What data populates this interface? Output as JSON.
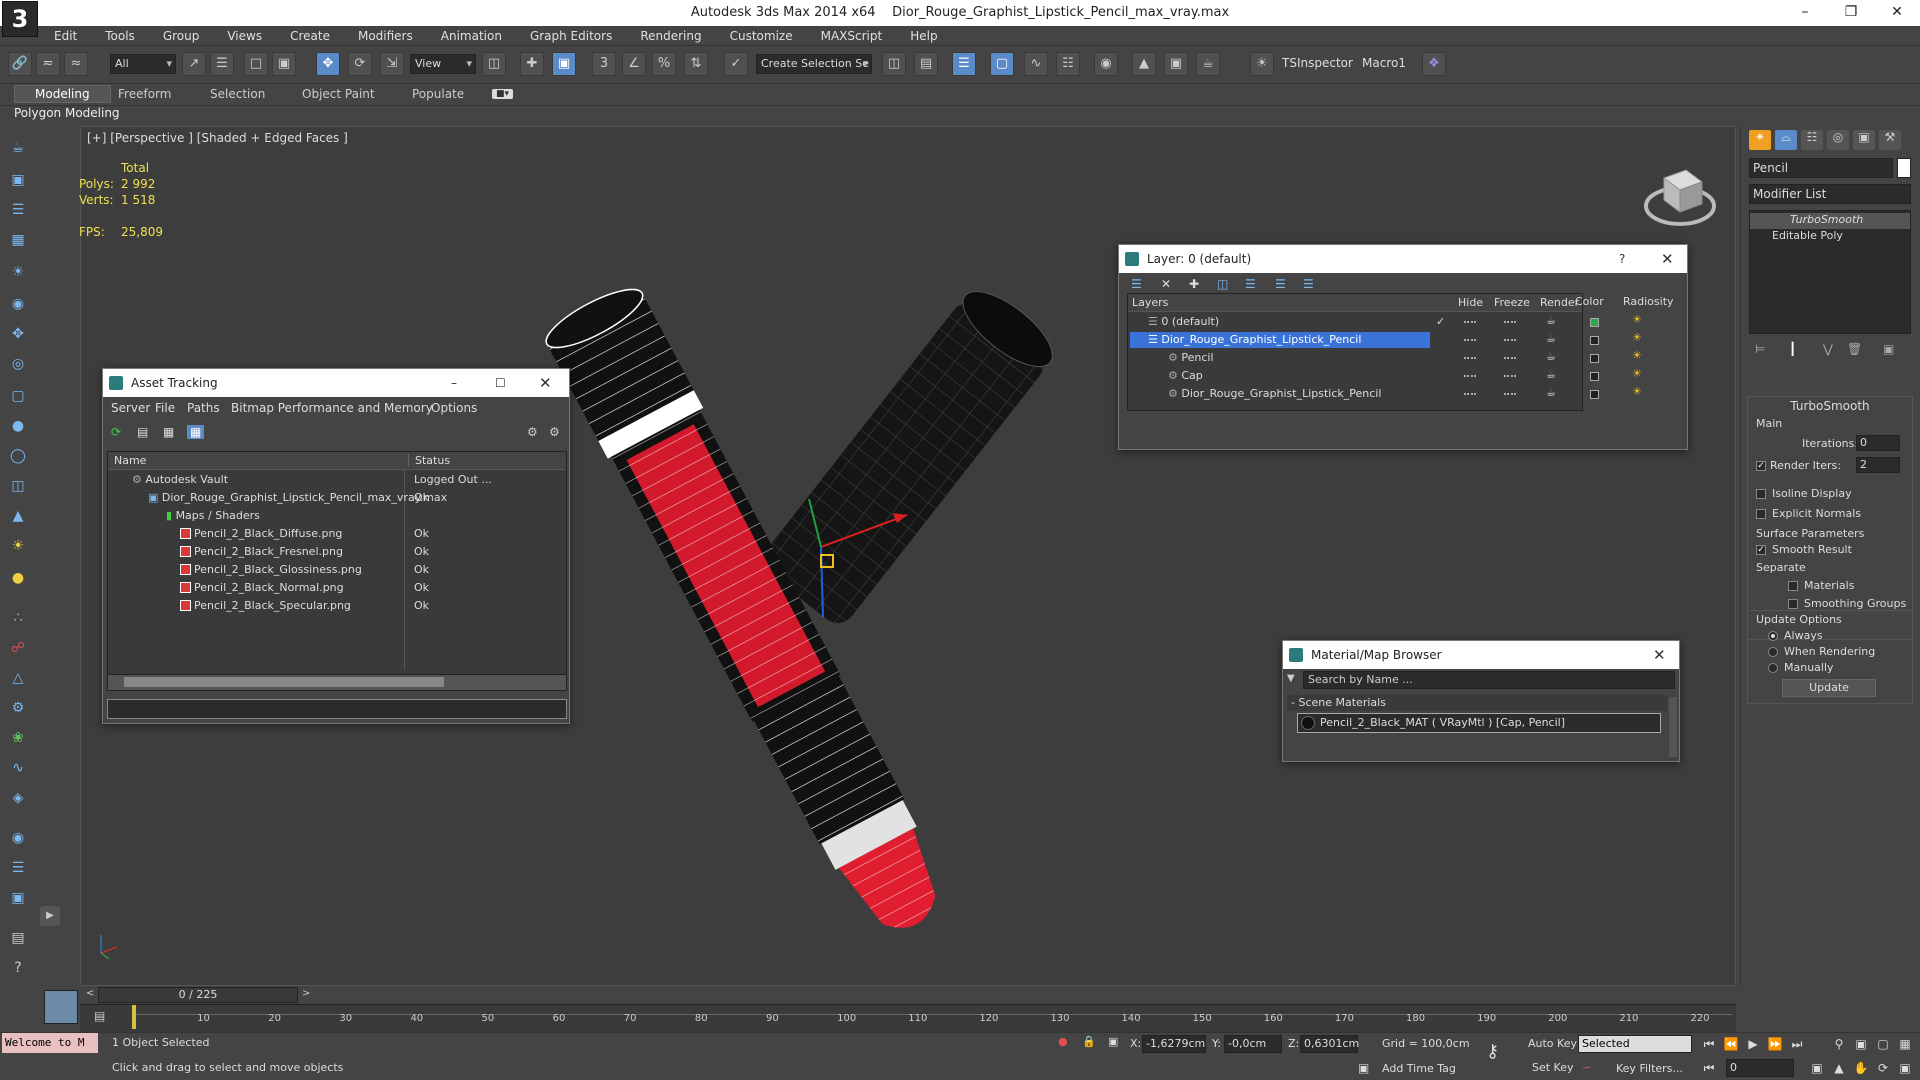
{
  "titlebar": {
    "app": "Autodesk 3ds Max  2014 x64",
    "file": "Dior_Rouge_Graphist_Lipstick_Pencil_max_vray.max",
    "logo": "3"
  },
  "menu": [
    "Edit",
    "Tools",
    "Group",
    "Views",
    "Create",
    "Modifiers",
    "Animation",
    "Graph Editors",
    "Rendering",
    "Customize",
    "MAXScript",
    "Help"
  ],
  "toolbar": {
    "filter": "All",
    "refcoord": "View",
    "selset": "Create Selection Se",
    "tsinspector": "TSInspector",
    "macro": "Macro1"
  },
  "ribbon": {
    "tabs": [
      "Modeling",
      "Freeform",
      "Selection",
      "Object Paint",
      "Populate"
    ],
    "sub": "Polygon Modeling"
  },
  "viewport": {
    "label": "[+] [Perspective ] [Shaded + Edged Faces ]",
    "stats": {
      "total": "Total",
      "polys_label": "Polys:",
      "polys": "2 992",
      "verts_label": "Verts:",
      "verts": "1 518",
      "fps_label": "FPS:",
      "fps": "25,809"
    }
  },
  "asset_tracking": {
    "title": "Asset Tracking",
    "menu": [
      "Server",
      "File",
      "Paths",
      "Bitmap Performance and Memory",
      "Options"
    ],
    "cols": [
      "Name",
      "Status"
    ],
    "rows": [
      {
        "name": "Autodesk Vault",
        "status": "Logged Out ..."
      },
      {
        "name": "Dior_Rouge_Graphist_Lipstick_Pencil_max_vray.max",
        "status": "Ok"
      },
      {
        "name": "Maps / Shaders",
        "status": ""
      },
      {
        "name": "Pencil_2_Black_Diffuse.png",
        "status": "Ok"
      },
      {
        "name": "Pencil_2_Black_Fresnel.png",
        "status": "Ok"
      },
      {
        "name": "Pencil_2_Black_Glossiness.png",
        "status": "Ok"
      },
      {
        "name": "Pencil_2_Black_Normal.png",
        "status": "Ok"
      },
      {
        "name": "Pencil_2_Black_Specular.png",
        "status": "Ok"
      }
    ]
  },
  "layers": {
    "title": "Layer: 0 (default)",
    "help": "?",
    "cols": [
      "Layers",
      "Hide",
      "Freeze",
      "Render",
      "Color",
      "Radiosity"
    ],
    "rows": [
      {
        "name": "0 (default)",
        "color": "#2aa84a"
      },
      {
        "name": "Dior_Rouge_Graphist_Lipstick_Pencil",
        "color": "#222222"
      },
      {
        "name": "Pencil",
        "color": "#222222"
      },
      {
        "name": "Cap",
        "color": "#222222"
      },
      {
        "name": "Dior_Rouge_Graphist_Lipstick_Pencil",
        "color": "#222222"
      }
    ]
  },
  "material_browser": {
    "title": "Material/Map Browser",
    "search_placeholder": "Search by Name ...",
    "section": "Scene Materials",
    "item": "Pencil_2_Black_MAT  ( VRayMtl ) [Cap, Pencil]"
  },
  "command_panel": {
    "object_name": "Pencil",
    "modifier_list": "Modifier List",
    "stack": [
      "TurboSmooth",
      "Editable Poly"
    ],
    "rollout_title": "TurboSmooth",
    "main": "Main",
    "iterations_label": "Iterations:",
    "iterations": "0",
    "render_iters_label": "Render Iters:",
    "render_iters": "2",
    "isoline": "Isoline Display",
    "explicit": "Explicit Normals",
    "surface": "Surface Parameters",
    "smooth_result": "Smooth Result",
    "separate": "Separate",
    "materials": "Materials",
    "smoothing_groups": "Smoothing Groups",
    "update_options": "Update Options",
    "always": "Always",
    "when_rendering": "When Rendering",
    "manually": "Manually",
    "update_btn": "Update"
  },
  "timeline": {
    "frame": "0 / 225",
    "ticks": [
      "10",
      "20",
      "30",
      "40",
      "50",
      "60",
      "70",
      "80",
      "90",
      "100",
      "110",
      "120",
      "130",
      "140",
      "150",
      "160",
      "170",
      "180",
      "190",
      "200",
      "210",
      "220"
    ]
  },
  "status": {
    "welcome": "Welcome to M",
    "selected": "1 Object Selected",
    "hint": "Click and drag to select and move objects",
    "x_label": "X:",
    "x": "-1,6279cm",
    "y_label": "Y:",
    "y": "-0,0cm",
    "z_label": "Z:",
    "z": "0,6301cm",
    "grid": "Grid = 100,0cm",
    "add_time_tag": "Add Time Tag",
    "auto_key": "Auto Key",
    "set_key": "Set Key",
    "selected_dd": "Selected",
    "key_filters": "Key Filters...",
    "frame_field": "0"
  }
}
